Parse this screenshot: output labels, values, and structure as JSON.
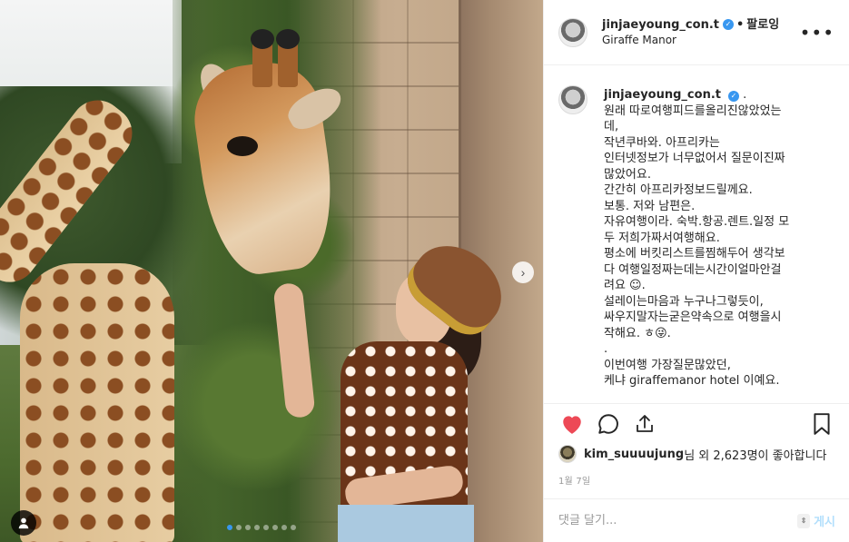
{
  "post": {
    "username": "jinjaeyoung_con.t",
    "follow_separator": "•",
    "follow_label": "팔로잉",
    "location": "Giraffe Manor",
    "more_label": "•••",
    "caption_suffix": ".",
    "caption_lines": [
      "원래 따로여행피드를올리진않았었는",
      "데,",
      "작년쿠바와. 아프리카는",
      "인터넷정보가 너무없어서 질문이진짜",
      "많았어요.",
      "간간히 아프리카정보드릴께요.",
      "보통. 저와 남편은.",
      "자유여행이라. 숙박.항공.렌트.일정 모",
      "두 저희가짜서여행해요.",
      "평소에 버킷리스트를찜해두어 생각보",
      "다 여행일정짜는데는시간이얼마안걸",
      "려요 ☺.",
      "설레이는마음과 누구나그렇듯이,",
      "싸우지말자는굳은약속으로 여행을시",
      "작해요. ㅎ😜.",
      ".",
      "이번여행 가장질문많았던,",
      "케냐 giraffemanor hotel 이예요."
    ],
    "likes_user": "kim_suuuujung",
    "likes_text": "님 외 2,623명이 좋아합니다",
    "date": "1월 7일",
    "comment_placeholder": "댓글 달기...",
    "post_button": "게시",
    "like_color": "#ed4956",
    "accent_color": "#3897f0"
  },
  "carousel": {
    "slide_count": 8,
    "active_index": 0
  },
  "icons": {
    "like": "heart-icon",
    "comment": "comment-icon",
    "share": "share-icon",
    "save": "bookmark-icon",
    "next": "chevron-right-icon",
    "tag": "user-tag-icon",
    "verified": "verified-badge-icon"
  }
}
